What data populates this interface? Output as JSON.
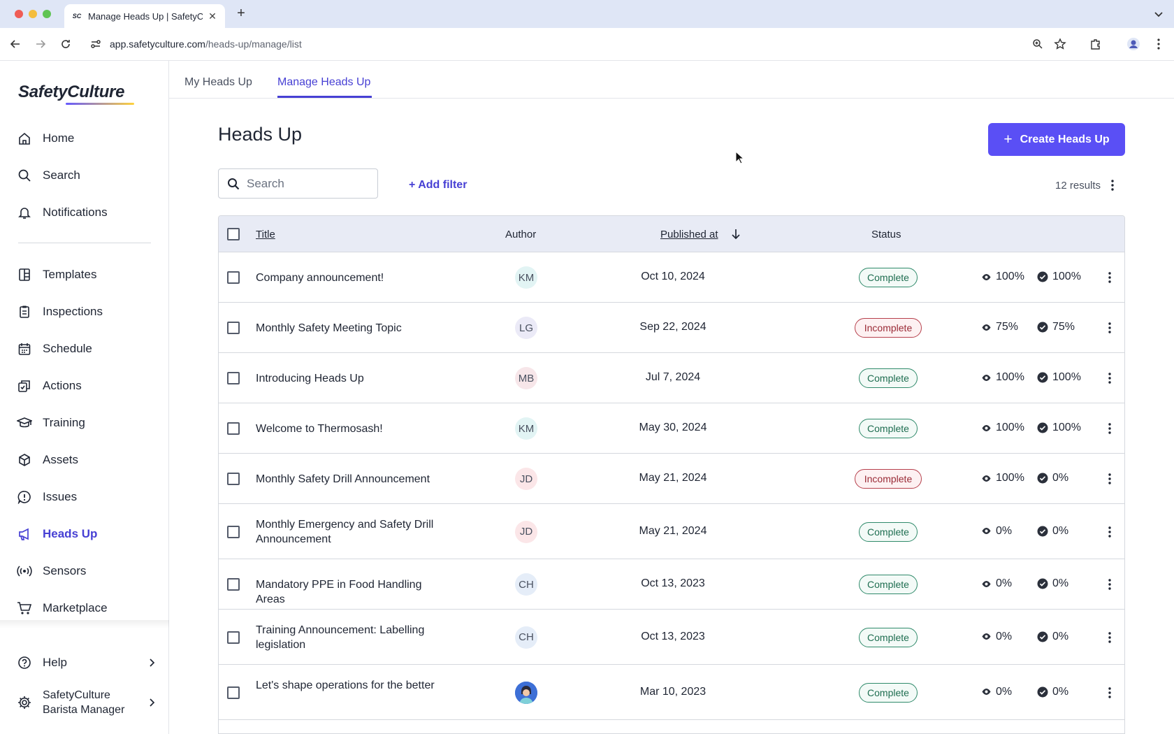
{
  "browser": {
    "tab_title": "Manage Heads Up | SafetyCul",
    "favicon_text": "SC",
    "url_host": "app.safetyculture.com",
    "url_path": "/heads-up/manage/list"
  },
  "sidebar": {
    "logo": "SafetyCulture",
    "nav": [
      {
        "label": "Home",
        "icon": "home-icon"
      },
      {
        "label": "Search",
        "icon": "search-icon"
      },
      {
        "label": "Notifications",
        "icon": "bell-icon"
      },
      {
        "label": "Templates",
        "icon": "templates-icon"
      },
      {
        "label": "Inspections",
        "icon": "clipboard-icon"
      },
      {
        "label": "Schedule",
        "icon": "calendar-icon"
      },
      {
        "label": "Actions",
        "icon": "actions-icon"
      },
      {
        "label": "Training",
        "icon": "graduation-cap-icon"
      },
      {
        "label": "Assets",
        "icon": "cube-icon"
      },
      {
        "label": "Issues",
        "icon": "alert-icon"
      },
      {
        "label": "Heads Up",
        "icon": "megaphone-icon"
      },
      {
        "label": "Sensors",
        "icon": "sensor-icon"
      },
      {
        "label": "Marketplace",
        "icon": "cart-icon"
      }
    ],
    "active_item": "Heads Up",
    "help_label": "Help",
    "account_line1": "SafetyCulture",
    "account_line2": "Barista Manager"
  },
  "page_tabs": {
    "my": "My Heads Up",
    "manage": "Manage Heads Up",
    "active": "Manage Heads Up"
  },
  "page": {
    "title": "Heads Up",
    "create_button": "Create Heads Up",
    "search_placeholder": "Search",
    "add_filter": "+ Add filter",
    "results": "12 results"
  },
  "table": {
    "headers": {
      "title": "Title",
      "author": "Author",
      "published": "Published at",
      "status": "Status"
    },
    "sort": {
      "column": "Published at",
      "direction": "descending"
    },
    "rows": [
      {
        "title": "Company announcement!",
        "author": "KM",
        "published": "Oct 10, 2024",
        "status": "Complete",
        "viewed": "100%",
        "acknowledged": "100%"
      },
      {
        "title": "Monthly Safety Meeting Topic",
        "author": "LG",
        "published": "Sep 22, 2024",
        "status": "Incomplete",
        "viewed": "75%",
        "acknowledged": "75%"
      },
      {
        "title": "Introducing Heads Up",
        "author": "MB",
        "published": "Jul 7, 2024",
        "status": "Complete",
        "viewed": "100%",
        "acknowledged": "100%"
      },
      {
        "title": "Welcome to Thermosash!",
        "author": "KM",
        "published": "May 30, 2024",
        "status": "Complete",
        "viewed": "100%",
        "acknowledged": "100%"
      },
      {
        "title": "Monthly Safety Drill Announcement",
        "author": "JD",
        "published": "May 21, 2024",
        "status": "Incomplete",
        "viewed": "100%",
        "acknowledged": "0%"
      },
      {
        "title": "Monthly Emergency and Safety Drill Announcement",
        "author": "JD",
        "published": "May 21, 2024",
        "status": "Complete",
        "viewed": "0%",
        "acknowledged": "0%"
      },
      {
        "title": "Mandatory PPE in Food Handling Areas",
        "author": "CH",
        "published": "Oct 13, 2023",
        "status": "Complete",
        "viewed": "0%",
        "acknowledged": "0%"
      },
      {
        "title": "Training Announcement: Labelling legislation",
        "author": "CH",
        "published": "Oct 13, 2023",
        "status": "Complete",
        "viewed": "0%",
        "acknowledged": "0%"
      },
      {
        "title": "Let's shape operations for the better",
        "author": "",
        "published": "Mar 10, 2023",
        "status": "Complete",
        "viewed": "0%",
        "acknowledged": "0%"
      }
    ]
  },
  "colors": {
    "brand": "#5a4ff5",
    "active_nav": "#4740d4",
    "complete": "#2f8a6a",
    "incomplete": "#b6404c"
  }
}
